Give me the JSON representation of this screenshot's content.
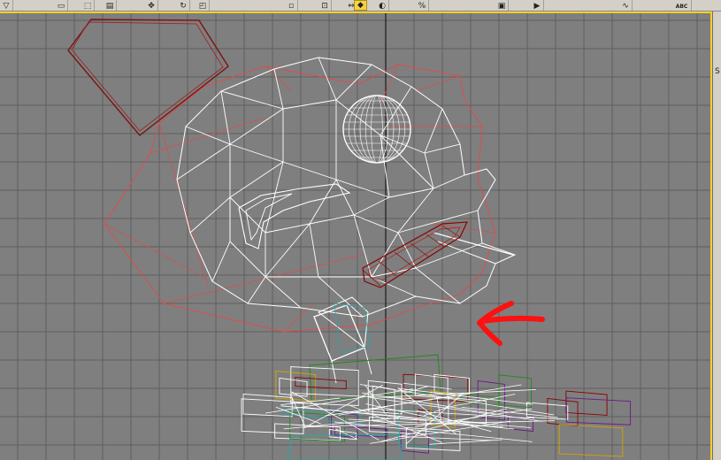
{
  "app": {
    "panel_label": "S"
  },
  "toolbar": {
    "buttons": [
      {
        "name": "select-filter-button",
        "glyph": "▽"
      },
      {
        "name": "select-object-button",
        "glyph": "▭"
      },
      {
        "name": "select-region-button",
        "glyph": "⬚"
      },
      {
        "name": "select-by-name-button",
        "glyph": "▤"
      },
      {
        "name": "select-move-button",
        "glyph": "✥"
      },
      {
        "name": "select-rotate-button",
        "glyph": "↻"
      },
      {
        "name": "select-scale-button",
        "glyph": "◰"
      },
      {
        "name": "reference-coord-button",
        "glyph": "▫"
      },
      {
        "name": "pivot-button",
        "glyph": "⊡"
      },
      {
        "name": "mirror-button",
        "glyph": "⇔"
      },
      {
        "name": "snap-toggle-button",
        "glyph": "◆"
      },
      {
        "name": "angle-snap-button",
        "glyph": "◐"
      },
      {
        "name": "percent-snap-button",
        "glyph": "%"
      },
      {
        "name": "render-button",
        "glyph": "▣"
      },
      {
        "name": "quick-render-button",
        "glyph": "▶"
      },
      {
        "name": "curve-editor-button",
        "glyph": "∿"
      },
      {
        "name": "spelling-button",
        "glyph": "ABC"
      }
    ]
  },
  "colors": {
    "viewport_bg": "#7f7f7f",
    "grid": "#5f5f5f",
    "grid_major": "#1a1a1a",
    "selected_wire": "#ffffff",
    "unselected_wire": "#e24a4a",
    "dark_red_wire": "#8b0000",
    "arrow_annotation": "#ff1010",
    "active_viewport_border": "#f5cf2a"
  }
}
